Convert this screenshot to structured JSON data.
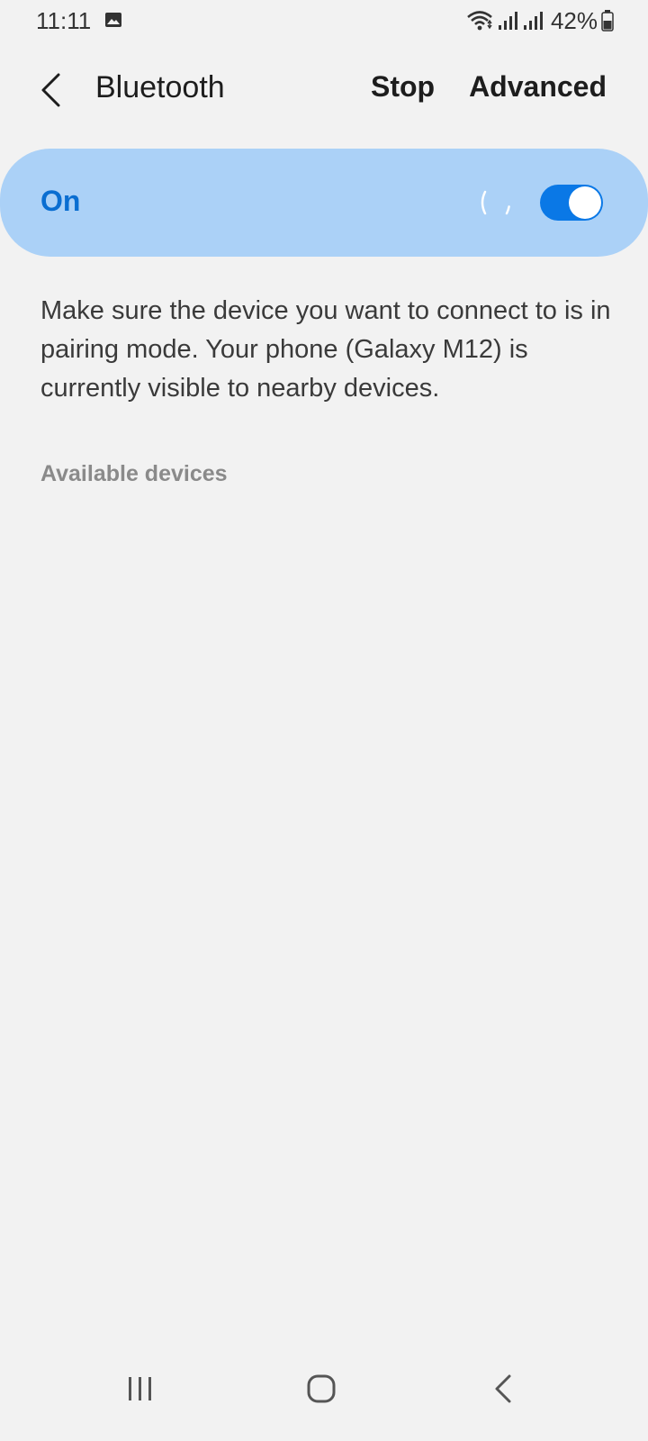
{
  "status_bar": {
    "time": "11:11",
    "battery": "42%",
    "icons": [
      "gallery-icon",
      "wifi-icon",
      "signal-icon",
      "signal-icon",
      "battery-icon"
    ]
  },
  "app_bar": {
    "title": "Bluetooth",
    "stop_label": "Stop",
    "advanced_label": "Advanced",
    "back_icon": "chevron-left-icon"
  },
  "master_toggle": {
    "label": "On",
    "enabled": true,
    "scanning": true,
    "accent_color": "#0a78e6",
    "card_color": "#abd1f7"
  },
  "description": "Make sure the device you want to connect to is in pairing mode. Your phone (Galaxy M12) is currently visible to nearby devices.",
  "available_devices": {
    "header": "Available devices",
    "items": []
  },
  "nav_bar": {
    "icons": [
      "recents-icon",
      "home-icon",
      "back-icon"
    ]
  }
}
